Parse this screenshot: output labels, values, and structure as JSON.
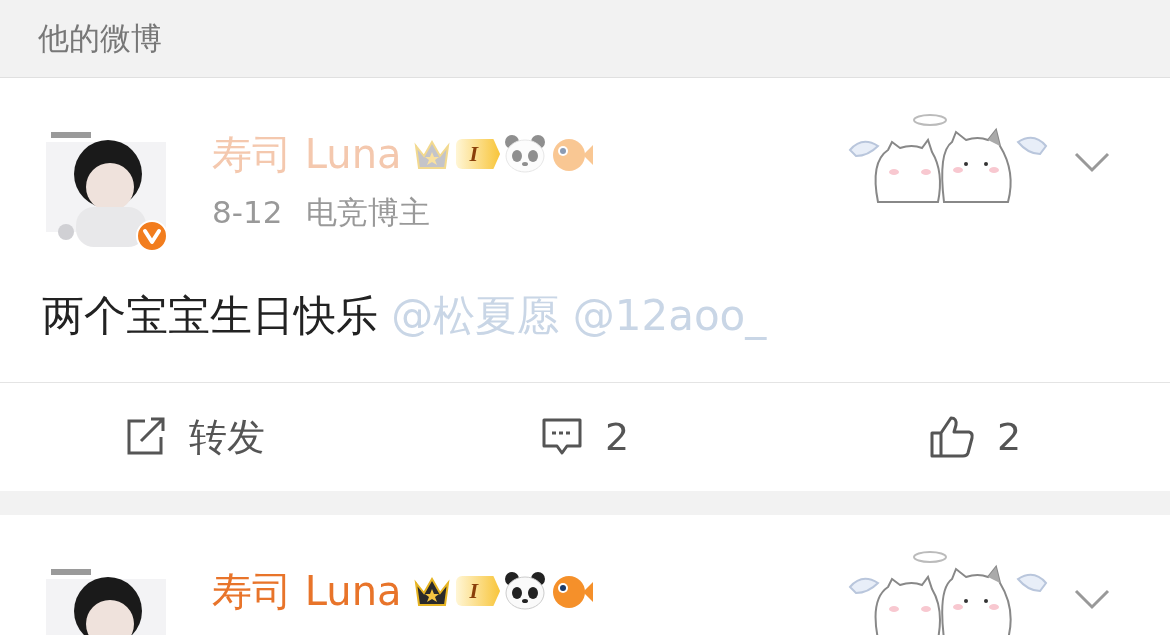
{
  "section_title": "他的微博",
  "posts": [
    {
      "name": "寿司 Luna",
      "name_faded": true,
      "level_badge": "I",
      "date": "8-12",
      "tag": "电竞博主",
      "text": "两个宝宝生日快乐",
      "mention": "@松夏愿 @12aoo_",
      "actions": [
        {
          "kind": "repost",
          "label": "转发"
        },
        {
          "kind": "comment",
          "label": "2"
        },
        {
          "kind": "like",
          "label": "2"
        }
      ]
    },
    {
      "name": "寿司 Luna",
      "name_faded": false,
      "level_badge": "I"
    }
  ]
}
